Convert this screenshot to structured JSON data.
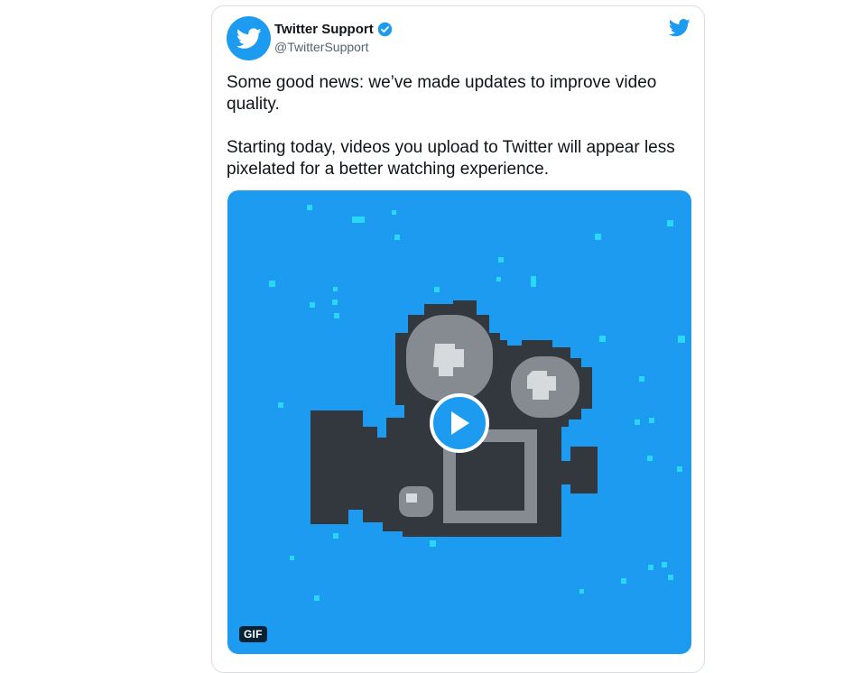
{
  "author": {
    "display_name": "Twitter Support",
    "handle": "@TwitterSupport",
    "verified": true,
    "avatar_icon": "twitter-bird-icon"
  },
  "tweet": {
    "paragraphs": [
      "Some good news: we’ve made updates to improve video quality.",
      "Starting today, videos you upload to Twitter will appear less pixelated for a better watching experience."
    ]
  },
  "media": {
    "type": "gif",
    "badge_label": "GIF",
    "subject_icon": "pixel-video-camera-icon",
    "play_icon": "play-icon"
  },
  "colors": {
    "brand_blue": "#1d9bf0",
    "media_background": "#1d9bf0",
    "camera_body": "#33383f",
    "camera_lens": "#868b92",
    "camera_highlight": "#d6dadd",
    "sparkle": "#2be3f6"
  }
}
